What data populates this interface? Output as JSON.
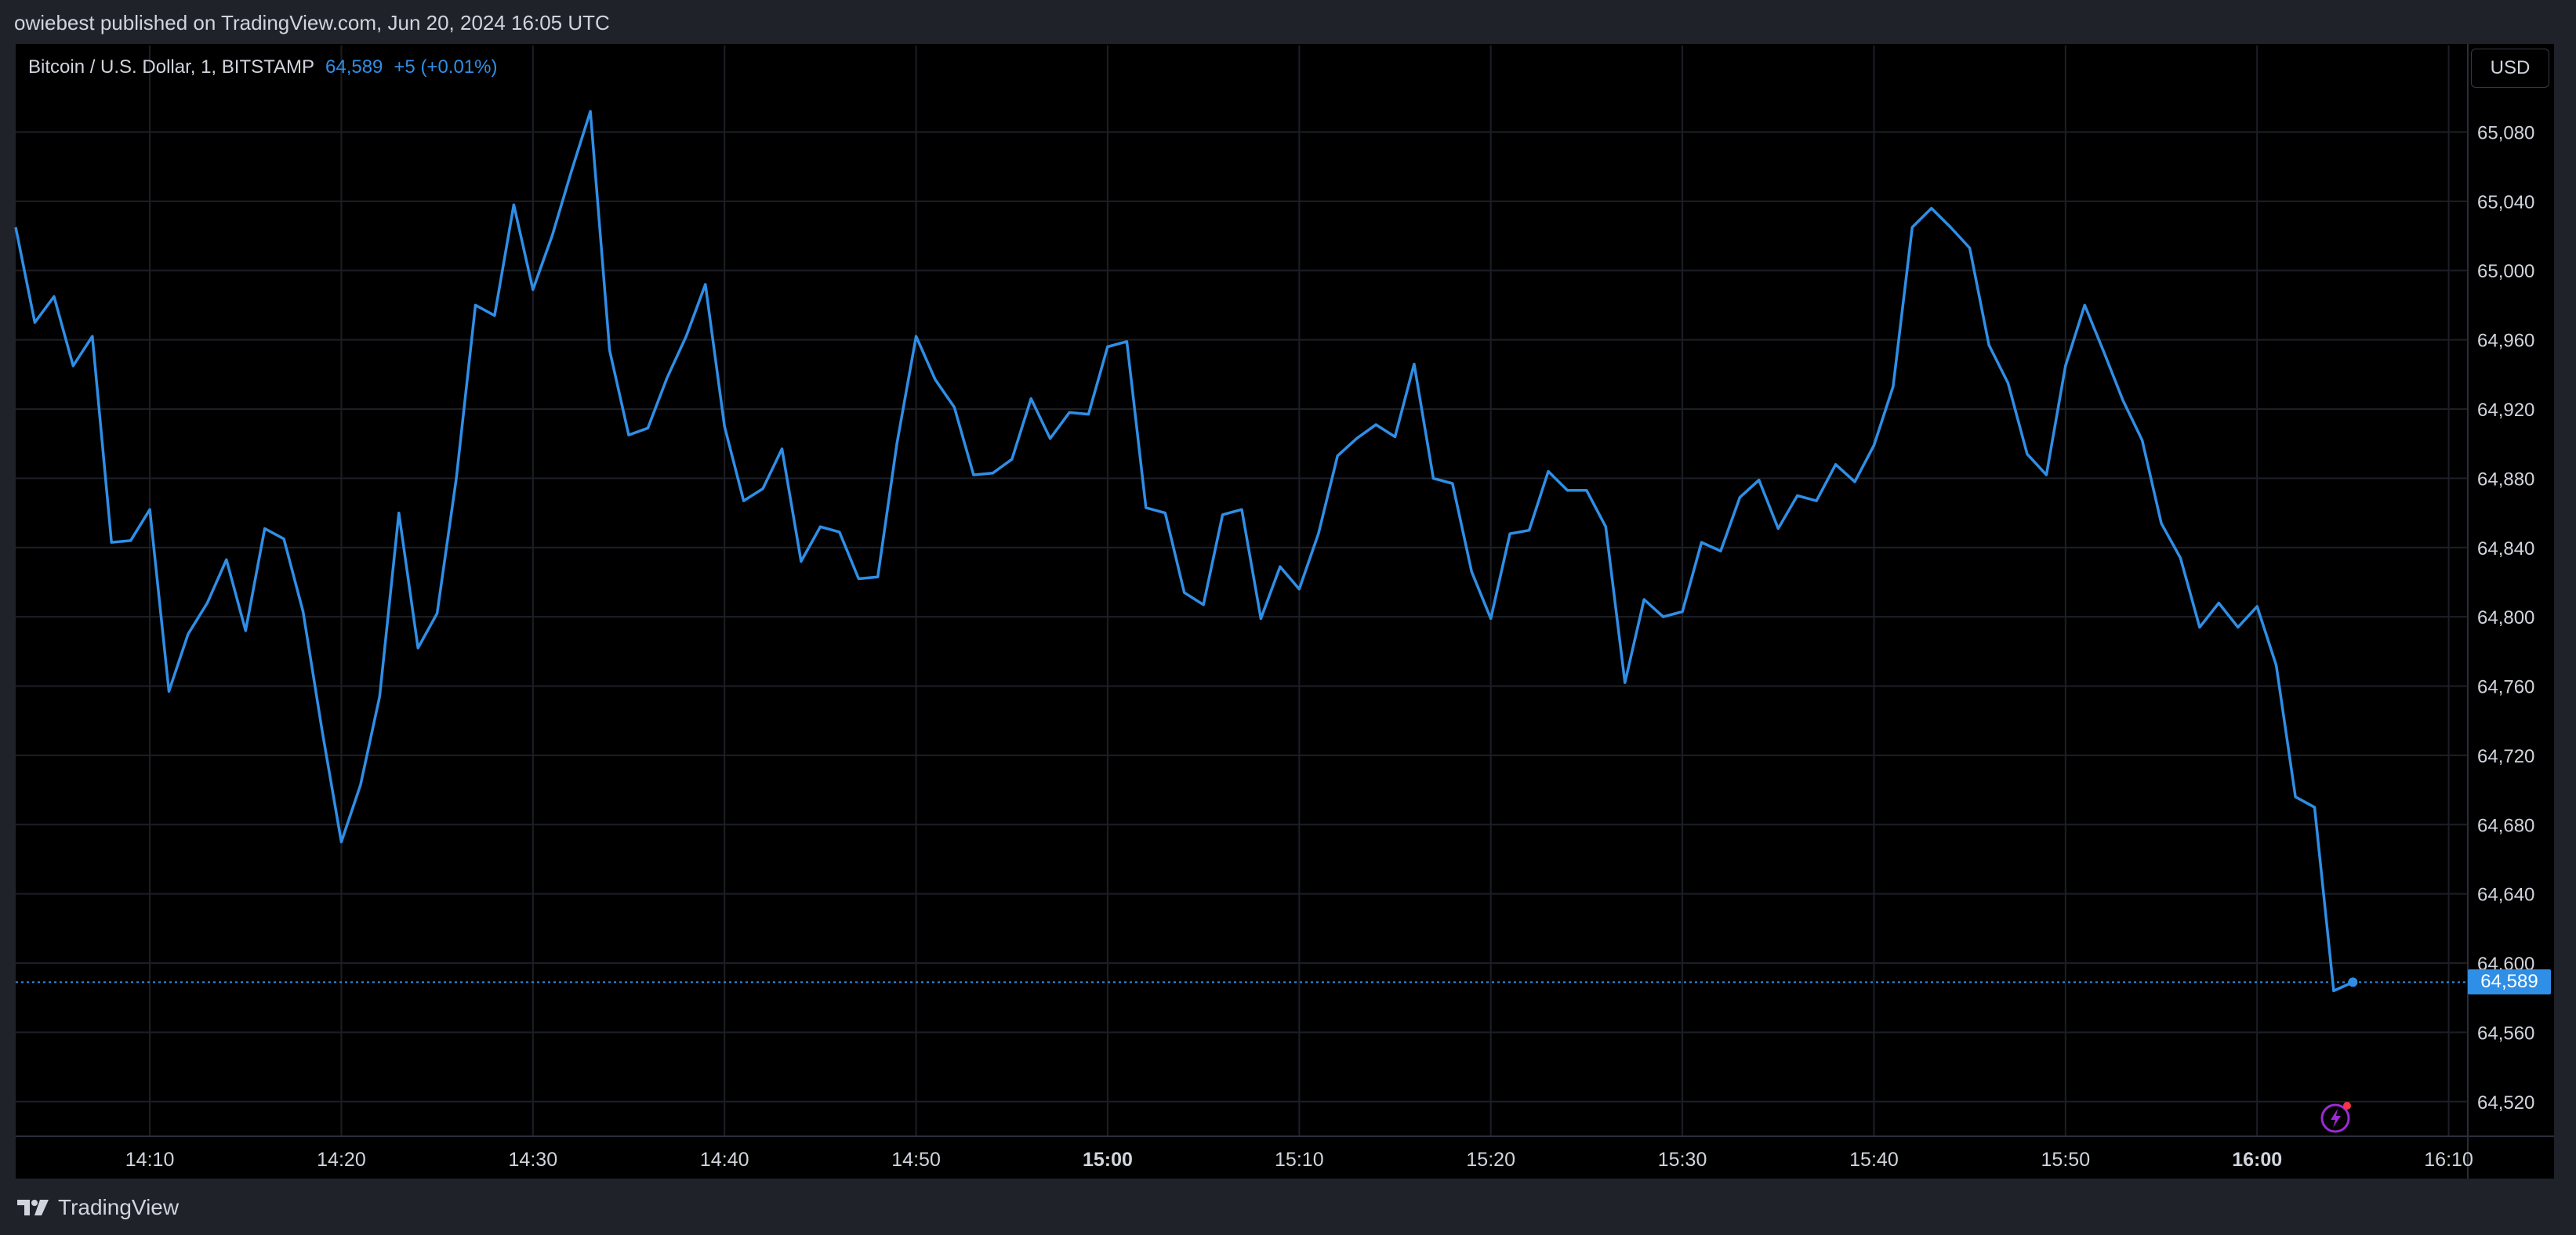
{
  "header": {
    "published": "owiebest published on TradingView.com, Jun 20, 2024 16:05 UTC"
  },
  "legend": {
    "symbol": "Bitcoin / U.S. Dollar, 1, BITSTAMP",
    "price": "64,589",
    "change": "+5 (+0.01%)"
  },
  "currency_button": "USD",
  "last_price_label": "64,589",
  "footer": {
    "brand": "TradingView"
  },
  "colors": {
    "background": "#000000",
    "line": "#2f8ee6",
    "grid": "#1c1f26",
    "axis_text": "#d1d4dc",
    "chrome": "#1f2229"
  },
  "icons": {
    "replay": "lightning-bolt-icon",
    "brand": "tradingview-logo-icon"
  },
  "chart_data": {
    "type": "line",
    "ylim": [
      64500,
      65130
    ],
    "grid": true,
    "last_price": 64589,
    "y_ticks": [
      {
        "value": 65080,
        "label": "65,080"
      },
      {
        "value": 65040,
        "label": "65,040"
      },
      {
        "value": 65000,
        "label": "65,000"
      },
      {
        "value": 64960,
        "label": "64,960"
      },
      {
        "value": 64920,
        "label": "64,920"
      },
      {
        "value": 64880,
        "label": "64,880"
      },
      {
        "value": 64840,
        "label": "64,840"
      },
      {
        "value": 64800,
        "label": "64,800"
      },
      {
        "value": 64760,
        "label": "64,760"
      },
      {
        "value": 64720,
        "label": "64,720"
      },
      {
        "value": 64680,
        "label": "64,680"
      },
      {
        "value": 64640,
        "label": "64,640"
      },
      {
        "value": 64600,
        "label": "64,600"
      },
      {
        "value": 64560,
        "label": "64,560"
      },
      {
        "value": 64520,
        "label": "64,520"
      }
    ],
    "x_ticks": [
      {
        "minute": 850,
        "label": "14:10",
        "bold": false
      },
      {
        "minute": 860,
        "label": "14:20",
        "bold": false
      },
      {
        "minute": 870,
        "label": "14:30",
        "bold": false
      },
      {
        "minute": 880,
        "label": "14:40",
        "bold": false
      },
      {
        "minute": 890,
        "label": "14:50",
        "bold": false
      },
      {
        "minute": 900,
        "label": "15:00",
        "bold": true
      },
      {
        "minute": 910,
        "label": "15:10",
        "bold": false
      },
      {
        "minute": 920,
        "label": "15:20",
        "bold": false
      },
      {
        "minute": 930,
        "label": "15:30",
        "bold": false
      },
      {
        "minute": 940,
        "label": "15:40",
        "bold": false
      },
      {
        "minute": 950,
        "label": "15:50",
        "bold": false
      },
      {
        "minute": 960,
        "label": "16:00",
        "bold": true
      },
      {
        "minute": 970,
        "label": "16:10",
        "bold": false
      }
    ],
    "x_start_minute": 843,
    "x_end_minute": 971,
    "series": [
      {
        "start_minute": 843,
        "values": [
          65025,
          64970,
          64985,
          64945,
          64962,
          64843,
          64844,
          64862,
          64757,
          64790,
          64808,
          64833,
          64792,
          64851,
          64845,
          64803,
          64734,
          64670,
          64703,
          64754,
          64860,
          64782,
          64802,
          64880,
          64980,
          64974,
          65038,
          64989,
          65020,
          65057,
          65092,
          64954,
          64905,
          64909,
          64938,
          64962,
          64992,
          64910,
          64867,
          64874,
          64897,
          64832,
          64852,
          64849,
          64822,
          64823,
          64900,
          64962,
          64937,
          64921,
          64882,
          64883,
          64891,
          64926,
          64903,
          64918,
          64917,
          64956,
          64959,
          64863,
          64860,
          64814,
          64807,
          64859,
          64862,
          64799,
          64829,
          64816,
          64848,
          64893,
          64903,
          64911,
          64904,
          64946,
          64880,
          64877,
          64826,
          64799,
          64848,
          64850,
          64884,
          64873,
          64873,
          64852,
          64762,
          64810,
          64800,
          64803,
          64843,
          64838,
          64869,
          64879,
          64851,
          64870,
          64867,
          64888,
          64878,
          64899,
          64933,
          65025,
          65036,
          65025,
          65013,
          64957,
          64935,
          64894,
          64882,
          64945,
          64980,
          64953,
          64925,
          64902,
          64854,
          64834,
          64794,
          64808,
          64794,
          64806,
          64772,
          64696,
          64690,
          64584,
          64589
        ]
      }
    ]
  }
}
